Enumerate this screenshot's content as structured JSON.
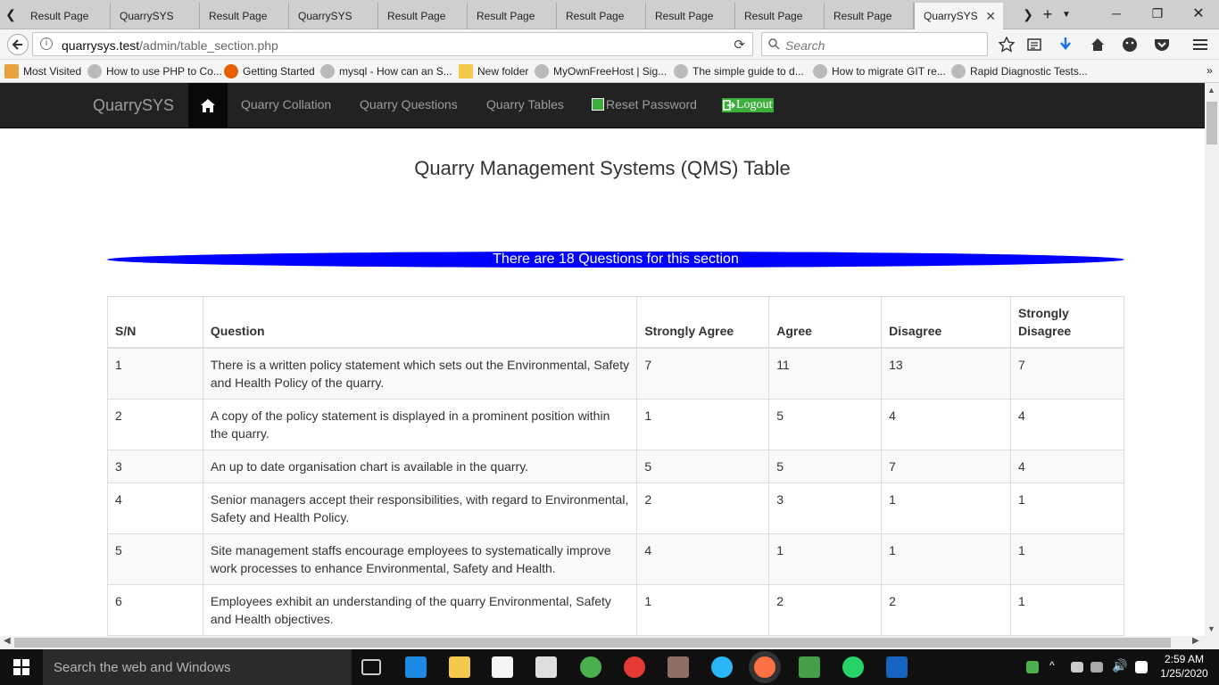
{
  "browser": {
    "tabs": [
      {
        "label": "Result Page",
        "active": false
      },
      {
        "label": "QuarrySYS",
        "active": false
      },
      {
        "label": "Result Page",
        "active": false
      },
      {
        "label": "QuarrySYS",
        "active": false
      },
      {
        "label": "Result Page",
        "active": false
      },
      {
        "label": "Result Page",
        "active": false
      },
      {
        "label": "Result Page",
        "active": false
      },
      {
        "label": "Result Page",
        "active": false
      },
      {
        "label": "Result Page",
        "active": false
      },
      {
        "label": "Result Page",
        "active": false
      },
      {
        "label": "QuarrySYS",
        "active": true
      }
    ],
    "url_host": "quarrysys.test",
    "url_path": "/admin/table_section.php",
    "search_placeholder": "Search",
    "bookmarks": [
      {
        "label": "Most Visited"
      },
      {
        "label": "How to use PHP to Co..."
      },
      {
        "label": "Getting Started"
      },
      {
        "label": "mysql - How can an S..."
      },
      {
        "label": "New folder"
      },
      {
        "label": "MyOwnFreeHost | Sig..."
      },
      {
        "label": "The simple guide to d..."
      },
      {
        "label": "How to migrate GIT re..."
      },
      {
        "label": "Rapid Diagnostic Tests..."
      }
    ]
  },
  "app": {
    "brand": "QuarrySYS",
    "nav": {
      "collation": "Quarry Collation",
      "questions": "Quarry Questions",
      "tables": "Quarry Tables",
      "reset": "Reset Password",
      "logout": "Logout"
    },
    "page_title": "Quarry Management Systems (QMS) Table",
    "banner": "There are 18 Questions for this section",
    "table": {
      "headers": {
        "sn": "S/N",
        "question": "Question",
        "strongly_agree": "Strongly Agree",
        "agree": "Agree",
        "disagree": "Disagree",
        "strongly_disagree": "Strongly Disagree"
      },
      "rows": [
        {
          "sn": "1",
          "question": "There is a written policy statement which sets out the Environmental, Safety and Health Policy of the quarry.",
          "sa": "7",
          "a": "11",
          "d": "13",
          "sd": "7"
        },
        {
          "sn": "2",
          "question": "A copy of the policy statement is displayed in a prominent position within the quarry.",
          "sa": "1",
          "a": "5",
          "d": "4",
          "sd": "4"
        },
        {
          "sn": "3",
          "question": "An up to date organisation chart is available in the quarry.",
          "sa": "5",
          "a": "5",
          "d": "7",
          "sd": "4"
        },
        {
          "sn": "4",
          "question": "Senior managers accept their responsibilities, with regard to Environmental, Safety and Health Policy.",
          "sa": "2",
          "a": "3",
          "d": "1",
          "sd": "1"
        },
        {
          "sn": "5",
          "question": "Site management staffs encourage employees to systematically improve work processes to enhance Environmental, Safety and Health.",
          "sa": "4",
          "a": "1",
          "d": "1",
          "sd": "1"
        },
        {
          "sn": "6",
          "question": "Employees exhibit an understanding of the quarry Environmental, Safety and Health objectives.",
          "sa": "1",
          "a": "2",
          "d": "2",
          "sd": "1"
        }
      ]
    }
  },
  "taskbar": {
    "search_placeholder": "Search the web and Windows",
    "time": "2:59 AM",
    "date": "1/25/2020"
  }
}
